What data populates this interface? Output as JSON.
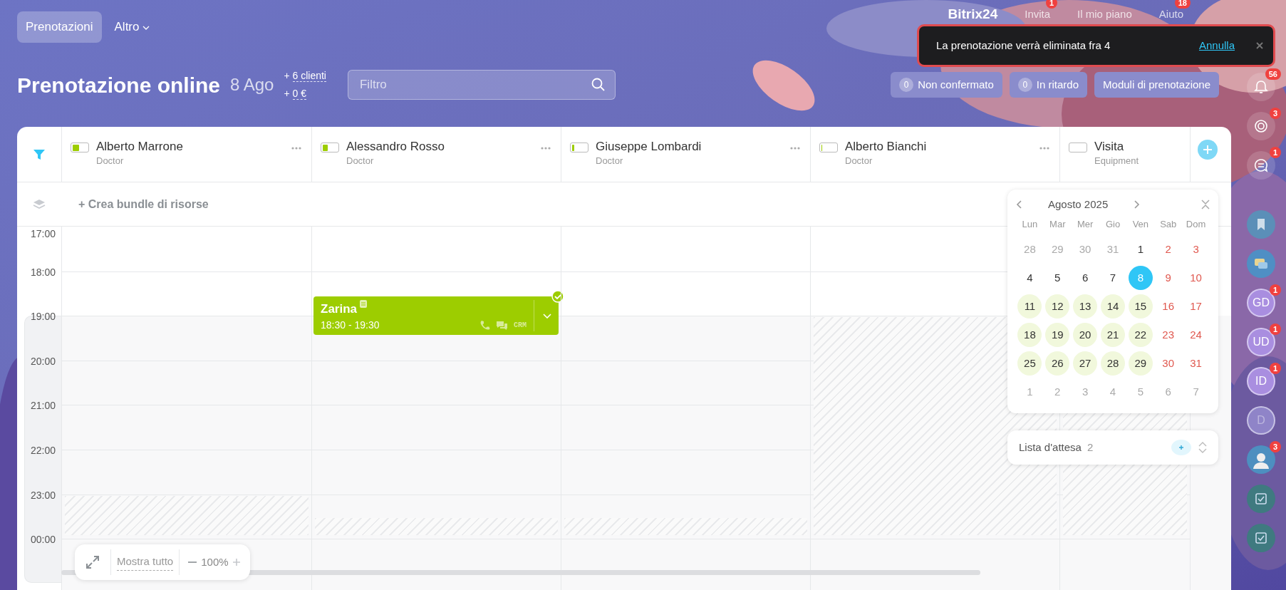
{
  "topbar": {
    "tabs": [
      {
        "label": "Prenotazioni",
        "selected": true
      },
      {
        "label": "Altro",
        "selected": false
      }
    ],
    "links": [
      {
        "label": "Bitrix24",
        "kind": "logo"
      },
      {
        "label": "Invita",
        "kind": "link",
        "badge": "1"
      },
      {
        "label": "Il mio piano",
        "kind": "link"
      },
      {
        "label": "Aiuto",
        "kind": "link",
        "badge": "18"
      }
    ]
  },
  "header": {
    "title": "Prenotazione online",
    "date": "8 Ago",
    "stats": [
      {
        "sign": "+",
        "label": "6 clienti"
      },
      {
        "sign": "+",
        "label": "0 €"
      }
    ],
    "filter": {
      "placeholder": "Filtro"
    },
    "counters": [
      {
        "count": "0",
        "label": "Non confermato"
      },
      {
        "count": "0",
        "label": "In ritardo"
      }
    ],
    "forms_button": "Moduli di prenotazione"
  },
  "resources": [
    {
      "name": "Alberto Marrone",
      "type": "Doctor",
      "level": 0.45,
      "kind": "late-hour"
    },
    {
      "name": "Alessandro Rosso",
      "type": "Doctor",
      "level": 0.35,
      "kind": "late-half-hour",
      "bookings": [
        {
          "title": "Zarina",
          "time": "18:30 - 19:30",
          "confirmed": true,
          "tag": "CRM"
        }
      ]
    },
    {
      "name": "Giuseppe Lombardi",
      "type": "Doctor",
      "level": 0.15,
      "kind": "late-half-hour"
    },
    {
      "name": "Alberto Bianchi",
      "type": "Doctor",
      "level": 0.05,
      "kind": "evening"
    },
    {
      "name": "Visita",
      "type": "Equipment",
      "level": 0,
      "kind": "evening"
    }
  ],
  "bundle_button": "+ Crea bundle di risorse",
  "schedule": {
    "hours": [
      "17:00",
      "18:00",
      "19:00",
      "20:00",
      "21:00",
      "22:00",
      "23:00",
      "00:00"
    ]
  },
  "calendar": {
    "month": "Agosto 2025",
    "weekdays": [
      "Lun",
      "Mar",
      "Mer",
      "Gio",
      "Ven",
      "Sab",
      "Dom"
    ],
    "weeks": [
      [
        {
          "day": "28",
          "kind": "outside",
          "selected": false,
          "available": false
        },
        {
          "day": "29",
          "kind": "outside",
          "selected": false,
          "available": false
        },
        {
          "day": "30",
          "kind": "outside",
          "selected": false,
          "available": false
        },
        {
          "day": "31",
          "kind": "outside",
          "selected": false,
          "available": false
        },
        {
          "day": "1",
          "kind": "workday",
          "selected": false,
          "available": false
        },
        {
          "day": "2",
          "kind": "weekend",
          "selected": false,
          "available": false
        },
        {
          "day": "3",
          "kind": "weekend",
          "selected": false,
          "available": false
        }
      ],
      [
        {
          "day": "4",
          "kind": "workday",
          "selected": false,
          "available": false
        },
        {
          "day": "5",
          "kind": "workday",
          "selected": false,
          "available": false
        },
        {
          "day": "6",
          "kind": "workday",
          "selected": false,
          "available": false
        },
        {
          "day": "7",
          "kind": "workday",
          "selected": false,
          "available": false
        },
        {
          "day": "8",
          "kind": "workday",
          "selected": true,
          "available": false
        },
        {
          "day": "9",
          "kind": "weekend",
          "selected": false,
          "available": false
        },
        {
          "day": "10",
          "kind": "weekend",
          "selected": false,
          "available": false
        }
      ],
      [
        {
          "day": "11",
          "kind": "workday",
          "selected": false,
          "available": true
        },
        {
          "day": "12",
          "kind": "workday",
          "selected": false,
          "available": true
        },
        {
          "day": "13",
          "kind": "workday",
          "selected": false,
          "available": true
        },
        {
          "day": "14",
          "kind": "workday",
          "selected": false,
          "available": true
        },
        {
          "day": "15",
          "kind": "workday",
          "selected": false,
          "available": true
        },
        {
          "day": "16",
          "kind": "weekend",
          "selected": false,
          "available": false
        },
        {
          "day": "17",
          "kind": "weekend",
          "selected": false,
          "available": false
        }
      ],
      [
        {
          "day": "18",
          "kind": "workday",
          "selected": false,
          "available": true
        },
        {
          "day": "19",
          "kind": "workday",
          "selected": false,
          "available": true
        },
        {
          "day": "20",
          "kind": "workday",
          "selected": false,
          "available": true
        },
        {
          "day": "21",
          "kind": "workday",
          "selected": false,
          "available": true
        },
        {
          "day": "22",
          "kind": "workday",
          "selected": false,
          "available": true
        },
        {
          "day": "23",
          "kind": "weekend",
          "selected": false,
          "available": false
        },
        {
          "day": "24",
          "kind": "weekend",
          "selected": false,
          "available": false
        }
      ],
      [
        {
          "day": "25",
          "kind": "workday",
          "selected": false,
          "available": true
        },
        {
          "day": "26",
          "kind": "workday",
          "selected": false,
          "available": true
        },
        {
          "day": "27",
          "kind": "workday",
          "selected": false,
          "available": true
        },
        {
          "day": "28",
          "kind": "workday",
          "selected": false,
          "available": true
        },
        {
          "day": "29",
          "kind": "workday",
          "selected": false,
          "available": true
        },
        {
          "day": "30",
          "kind": "weekend",
          "selected": false,
          "available": false
        },
        {
          "day": "31",
          "kind": "weekend",
          "selected": false,
          "available": false
        }
      ],
      [
        {
          "day": "1",
          "kind": "outside",
          "selected": false,
          "available": false
        },
        {
          "day": "2",
          "kind": "outside",
          "selected": false,
          "available": false
        },
        {
          "day": "3",
          "kind": "outside",
          "selected": false,
          "available": false
        },
        {
          "day": "4",
          "kind": "outside",
          "selected": false,
          "available": false
        },
        {
          "day": "5",
          "kind": "outside",
          "selected": false,
          "available": false
        },
        {
          "day": "6",
          "kind": "outside",
          "selected": false,
          "available": false
        },
        {
          "day": "7",
          "kind": "outside",
          "selected": false,
          "available": false
        }
      ]
    ]
  },
  "waitlist": {
    "label": "Lista d'attesa",
    "count": "2"
  },
  "zoom_toolbar": {
    "show_all": "Mostra tutto",
    "zoom": "100%"
  },
  "sidebar": [
    {
      "kind": "bell",
      "badge": "56"
    },
    {
      "kind": "target",
      "badge": "3"
    },
    {
      "kind": "sync-chat",
      "badge": "1"
    },
    {
      "kind": "bookmark"
    },
    {
      "kind": "chat"
    },
    {
      "kind": "initials",
      "text": "GD",
      "badge": "1",
      "dimmed": false
    },
    {
      "kind": "initials",
      "text": "UD",
      "badge": "1",
      "dimmed": false
    },
    {
      "kind": "initials",
      "text": "ID",
      "badge": "1",
      "dimmed": false
    },
    {
      "kind": "initials",
      "text": "D",
      "dimmed": true
    },
    {
      "kind": "avatar",
      "badge": "3"
    },
    {
      "kind": "task"
    },
    {
      "kind": "task"
    }
  ],
  "toast": {
    "message": "La prenotazione verrà eliminata fra 4",
    "action": "Annulla"
  }
}
